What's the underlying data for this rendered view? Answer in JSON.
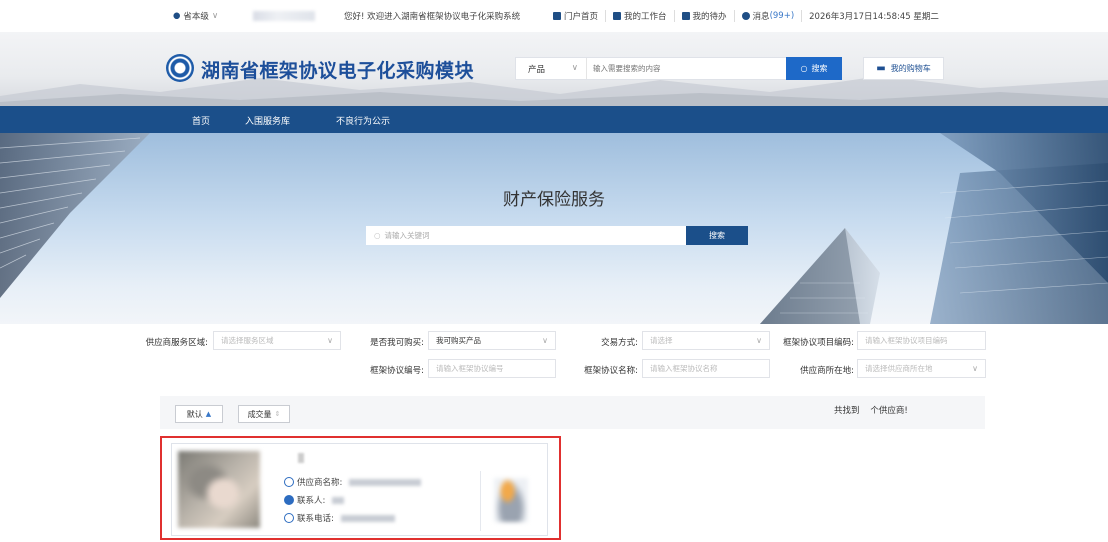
{
  "topbar": {
    "region": "省本级",
    "welcome": "您好! 欢迎进入湖南省框架协议电子化采购系统",
    "links": {
      "portal": "门户首页",
      "workbench": "我的工作台",
      "todo": "我的待办",
      "messages": "消息",
      "message_count": "(99+)"
    },
    "datetime": "2026年3月17日14:58:45 星期二"
  },
  "header": {
    "title": "湖南省框架协议电子化采购模块",
    "search_category": "产品",
    "search_placeholder": "输入需要搜索的内容",
    "search_button": "搜索",
    "cart_button": "我的购物车"
  },
  "nav": {
    "items": [
      "首页",
      "入围服务库",
      "不良行为公示"
    ]
  },
  "banner": {
    "title": "财产保险服务",
    "keyword_placeholder": "请输入关键词",
    "search_button": "搜索"
  },
  "filters": {
    "service_area": {
      "label": "供应商服务区域:",
      "placeholder": "请选择服务区域"
    },
    "can_buy": {
      "label": "是否我可购买:",
      "value": "我可购买产品"
    },
    "trade_method": {
      "label": "交易方式:",
      "placeholder": "请选择"
    },
    "project_code": {
      "label": "框架协议项目编码:",
      "placeholder": "请输入框架协议项目编码"
    },
    "agreement_no": {
      "label": "框架协议编号:",
      "placeholder": "请输入框架协议编号"
    },
    "agreement_name": {
      "label": "框架协议名称:",
      "placeholder": "请输入框架协议名称"
    },
    "supplier_location": {
      "label": "供应商所在地:",
      "placeholder": "请选择供应商所在地"
    }
  },
  "sort": {
    "default": "默认",
    "volume": "成交量",
    "found_prefix": "共找到",
    "found_suffix": "个供应商!"
  },
  "card": {
    "supplier_label": "供应商名称:",
    "contact_label": "联系人:",
    "phone_label": "联系电话:"
  },
  "colors": {
    "brand_blue": "#1b4f8a",
    "accent_blue": "#1e69c8",
    "highlight_red": "#e0302f"
  }
}
